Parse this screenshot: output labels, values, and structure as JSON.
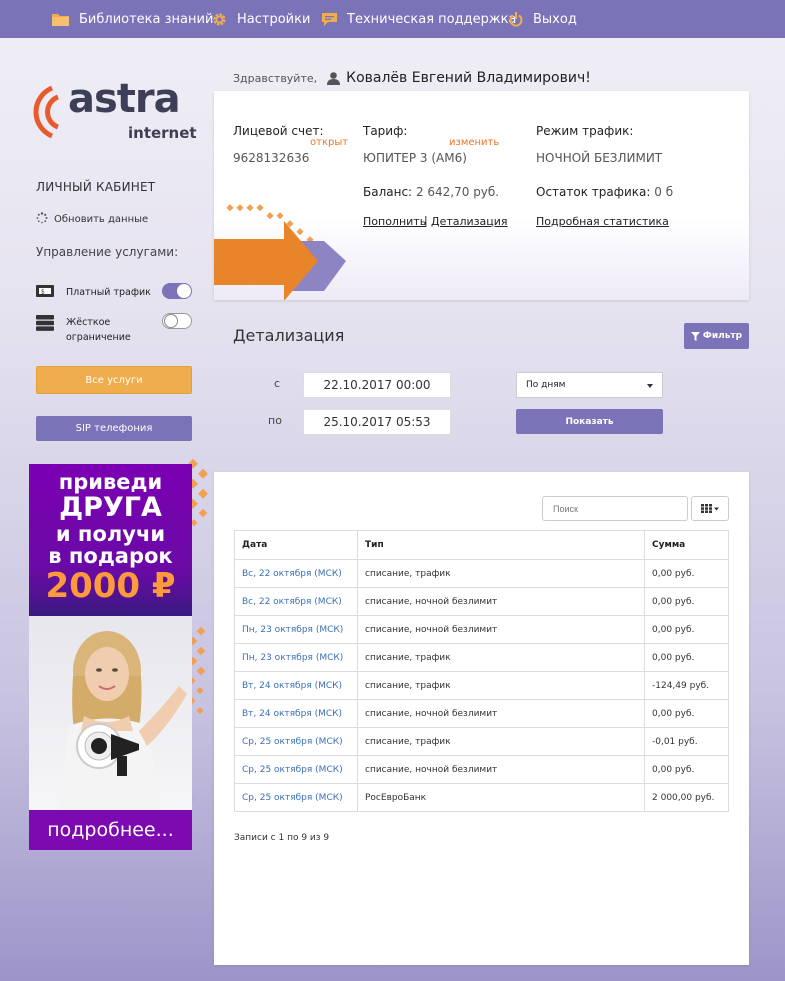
{
  "nav": [
    {
      "label": "Библиотека знаний",
      "icon": "folder-icon"
    },
    {
      "label": "Настройки",
      "icon": "gear-icon"
    },
    {
      "label": "Техническая поддержка",
      "icon": "chat-icon"
    },
    {
      "label": "Выход",
      "icon": "power-icon"
    }
  ],
  "logo": {
    "word": "astra",
    "sub": "internet"
  },
  "sidebar": {
    "title": "ЛИЧНЫЙ КАБИНЕТ",
    "refresh": "Обновить данные",
    "manage": "Управление услугами:",
    "services": [
      {
        "label": "Платный трафик",
        "enabled": true
      },
      {
        "label": "Жёсткое ограничение",
        "enabled": false
      }
    ],
    "all_services": "Все услуги",
    "sip": "SIP телефония"
  },
  "banner": {
    "line1": "приведи",
    "line2": "ДРУГА",
    "line3": "и получи",
    "line4": "в подарок",
    "price": "2000 ₽",
    "more": "подробнее..."
  },
  "greeting": {
    "hello": "Здравствуйте,",
    "name": "Ковалёв Евгений Владимирович!"
  },
  "account": {
    "account_label": "Лицевой счет:",
    "account_status": "открыт",
    "account_number": "9628132636",
    "tariff_label": "Тариф:",
    "tariff_change": "изменить",
    "tariff_value": "ЮПИТЕР 3 (АМ6)",
    "mode_label": "Режим трафик:",
    "mode_value": "НОЧНОЙ БЕЗЛИМИТ",
    "balance_label": "Баланс:",
    "balance_value": "2 642,70 руб.",
    "remain_label": "Остаток трафика:",
    "remain_value": "0 б",
    "topup": "Пополнить",
    "sep": "|",
    "details": "Детализация",
    "stats": "Подробная статистика"
  },
  "detail": {
    "title": "Детализация",
    "filter": "Фильтр",
    "from_label": "с",
    "from_value": "22.10.2017 00:00",
    "to_label": "по",
    "to_value": "25.10.2017 05:53",
    "group": "По дням",
    "show": "Показать"
  },
  "table": {
    "search_placeholder": "Поиск",
    "headers": [
      "Дата",
      "Тип",
      "Сумма"
    ],
    "rows": [
      [
        "Вс, 22 октября (МСК)",
        "списание, трафик",
        "0,00 руб."
      ],
      [
        "Вс, 22 октября (МСК)",
        "списание, ночной безлимит",
        "0,00 руб."
      ],
      [
        "Пн, 23 октября (МСК)",
        "списание, ночной безлимит",
        "0,00 руб."
      ],
      [
        "Пн, 23 октября (МСК)",
        "списание, трафик",
        "0,00 руб."
      ],
      [
        "Вт, 24 октября (МСК)",
        "списание, трафик",
        "-124,49 руб."
      ],
      [
        "Вт, 24 октября (МСК)",
        "списание, ночной безлимит",
        "0,00 руб."
      ],
      [
        "Ср, 25 октября (МСК)",
        "списание, трафик",
        "-0,01 руб."
      ],
      [
        "Ср, 25 октября (МСК)",
        "списание, ночной безлимит",
        "0,00 руб."
      ],
      [
        "Ср, 25 октября (МСК)",
        "РосЕвроБанк",
        "2 000,00 руб."
      ]
    ],
    "records": "Записи с 1 по 9 из 9"
  },
  "colors": {
    "nav": "#7b73b8",
    "accent_orange": "#f0ad4e",
    "link_orange": "#e8762b",
    "link_blue": "#3b6fb6"
  }
}
